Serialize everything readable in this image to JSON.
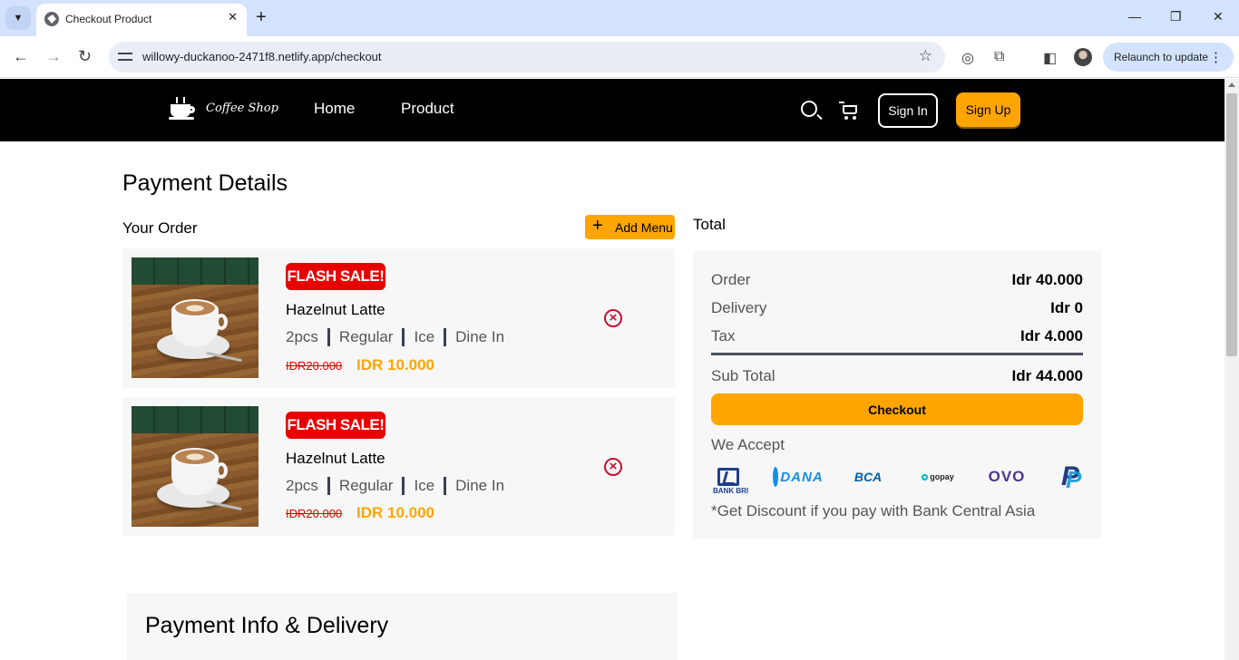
{
  "browser": {
    "tab_title": "Checkout Product",
    "url": "willowy-duckanoo-2471f8.netlify.app/checkout",
    "relaunch_label": "Relaunch to update"
  },
  "site": {
    "brand": "Coffee Shop",
    "nav": {
      "home": "Home",
      "product": "Product"
    },
    "sign_in": "Sign In",
    "sign_up": "Sign Up"
  },
  "page": {
    "title": "Payment Details",
    "your_order": "Your Order",
    "add_menu": "Add Menu",
    "total_heading": "Total"
  },
  "orders": [
    {
      "badge": "FLASH SALE!",
      "name": "Hazelnut Latte",
      "qty": "2pcs",
      "size": "Regular",
      "temp": "Ice",
      "dine": "Dine In",
      "old_price": "IDR20.000",
      "price": "IDR 10.000"
    },
    {
      "badge": "FLASH SALE!",
      "name": "Hazelnut Latte",
      "qty": "2pcs",
      "size": "Regular",
      "temp": "Ice",
      "dine": "Dine In",
      "old_price": "IDR20.000",
      "price": "IDR 10.000"
    }
  ],
  "totals": {
    "order_label": "Order",
    "order_value": "Idr 40.000",
    "delivery_label": "Delivery",
    "delivery_value": "Idr 0",
    "tax_label": "Tax",
    "tax_value": "Idr 4.000",
    "subtotal_label": "Sub Total",
    "subtotal_value": "Idr 44.000",
    "checkout_label": "Checkout",
    "we_accept": "We Accept",
    "payment_methods": {
      "bri": "BANK BRI",
      "dana": "DANA",
      "bca": "BCA",
      "gopay": "gopay",
      "ovo": "OVO",
      "paypal": "P"
    },
    "discount_note": "*Get Discount if you pay with Bank Central Asia"
  },
  "payment_info": {
    "title": "Payment Info & Delivery"
  },
  "colors": {
    "accent": "#ffa500",
    "sale": "#e80000",
    "nav_bg": "#000000",
    "card_bg": "#f7f7f7"
  }
}
